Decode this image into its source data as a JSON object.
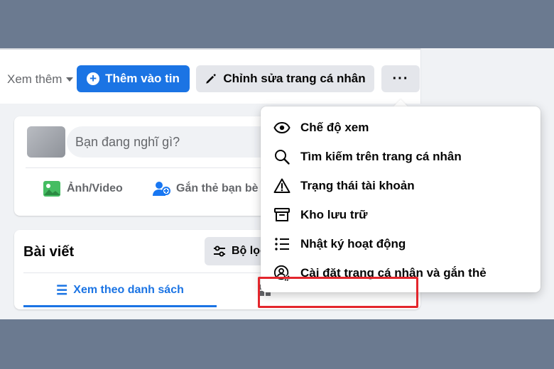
{
  "topbar": {
    "see_more": "Xem thêm",
    "add_story": "Thêm vào tin",
    "edit_profile": "Chỉnh sửa trang cá nhân",
    "more": "···"
  },
  "composer": {
    "placeholder": "Bạn đang nghĩ gì?",
    "photo_video": "Ảnh/Video",
    "tag_friends": "Gắn thẻ bạn bè"
  },
  "posts": {
    "title": "Bài viết",
    "filter": "Bộ lọc",
    "list_view": "Xem theo danh sách"
  },
  "menu": {
    "items": [
      {
        "label": "Chế độ xem",
        "icon": "eye-icon"
      },
      {
        "label": "Tìm kiếm trên trang cá nhân",
        "icon": "search-icon"
      },
      {
        "label": "Trạng thái tài khoản",
        "icon": "warning-icon"
      },
      {
        "label": "Kho lưu trữ",
        "icon": "archive-icon"
      },
      {
        "label": "Nhật ký hoạt động",
        "icon": "list-icon"
      },
      {
        "label": "Cài đặt trang cá nhân và gắn thẻ",
        "icon": "profile-settings-icon"
      }
    ]
  },
  "colors": {
    "accent": "#1b74e4",
    "highlight": "#e3262c",
    "background": "#f0f2f5"
  }
}
